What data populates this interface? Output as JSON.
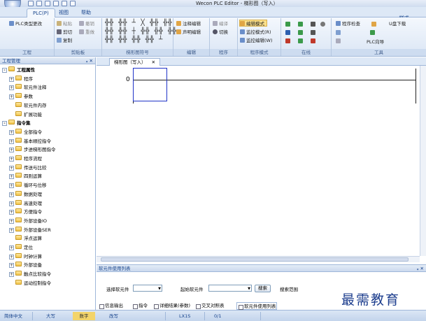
{
  "window": {
    "title": "Wecon PLC Editor - 梯形图（写入）"
  },
  "menu_tabs": [
    {
      "label": "PLC(P)",
      "active": true
    },
    {
      "label": "视图",
      "active": false
    },
    {
      "label": "帮助",
      "active": false
    }
  ],
  "style_menu": "样式 ·",
  "ribbon": {
    "project": {
      "group_label": "工程",
      "plc_type_change": "PLC类型更改"
    },
    "clipboard": {
      "group_label": "剪贴板",
      "paste": "粘贴",
      "undo": "撤销",
      "cut": "剪切",
      "redo": "重做",
      "copy": "复制"
    },
    "ladder_symbols": {
      "group_label": "梯形图符号",
      "rows": [
        "╬╬ ╬╬ ┴ ╳ ╬╬ ╬╬",
        "╬╬ ╬╬ ┼ ╬╬ ╬╬ ╬╬",
        "╬╬ ╬╬ ╬╬ ╬╬ ┴"
      ]
    },
    "edit": {
      "group_label": "编辑",
      "comment_edit": "注释编辑",
      "statement_edit": "声明编辑"
    },
    "program": {
      "group_label": "程序",
      "compile": "编译",
      "switch": "切换"
    },
    "program_mode": {
      "group_label": "程序模式",
      "edit_mode": "编辑模式",
      "monitor_mode": "监控模式(R)",
      "monitor_edit": "监控编辑(W)"
    },
    "online": {
      "group_label": "在线"
    },
    "tools": {
      "group_label": "工具",
      "program_check": "程序检查",
      "plc_wizard": "PLC向导"
    },
    "u_download": "U盘下载"
  },
  "left_panel": {
    "header": "工程管理",
    "pin": "ᵩ ✕",
    "tree": [
      {
        "label": "工程属性",
        "bold": true,
        "level": 0,
        "toggle": "-"
      },
      {
        "label": "程序",
        "level": 1,
        "toggle": "+"
      },
      {
        "label": "软元件注释",
        "level": 1,
        "toggle": "+"
      },
      {
        "label": "参数",
        "level": 1,
        "toggle": "+"
      },
      {
        "label": "软元件内存",
        "level": 1,
        "toggle": ""
      },
      {
        "label": "扩展功能",
        "level": 1,
        "toggle": ""
      },
      {
        "label": "指令集",
        "bold": true,
        "level": 0,
        "toggle": "-"
      },
      {
        "label": "全部指令",
        "level": 1,
        "toggle": "+"
      },
      {
        "label": "基本顺控指令",
        "level": 1,
        "toggle": "+"
      },
      {
        "label": "步进梯形图指令",
        "level": 1,
        "toggle": "+"
      },
      {
        "label": "程序流程",
        "level": 1,
        "toggle": "+"
      },
      {
        "label": "传送与比较",
        "level": 1,
        "toggle": "+"
      },
      {
        "label": "四则运算",
        "level": 1,
        "toggle": "+"
      },
      {
        "label": "循环与位移",
        "level": 1,
        "toggle": "+"
      },
      {
        "label": "数据处理",
        "level": 1,
        "toggle": "+"
      },
      {
        "label": "高速处理",
        "level": 1,
        "toggle": "+"
      },
      {
        "label": "方便指令",
        "level": 1,
        "toggle": "+"
      },
      {
        "label": "外部设备IO",
        "level": 1,
        "toggle": "+"
      },
      {
        "label": "外部设备SER",
        "level": 1,
        "toggle": "+"
      },
      {
        "label": "浮点运算",
        "level": 1,
        "toggle": ""
      },
      {
        "label": "定位",
        "level": 1,
        "toggle": "+"
      },
      {
        "label": "时钟计算",
        "level": 1,
        "toggle": "+"
      },
      {
        "label": "外部设备",
        "level": 1,
        "toggle": "+"
      },
      {
        "label": "触点比较指令",
        "level": 1,
        "toggle": "+"
      },
      {
        "label": "运动控制指令",
        "level": 1,
        "toggle": ""
      }
    ]
  },
  "editor": {
    "tab_label": "梯形图（写入）",
    "tab_close": "✕",
    "step_number": "0"
  },
  "bottom_panel": {
    "header": "软元件使用列表",
    "pin": "ᵩ ✕",
    "select_label": "选择软元件",
    "start_label": "起始软元件",
    "search_button": "搜索",
    "range_label": "搜索范围",
    "tabs": [
      {
        "label": "信息输出",
        "active": false
      },
      {
        "label": "指令",
        "active": false
      },
      {
        "label": "详细结果(参数)",
        "active": false
      },
      {
        "label": "交叉对照表",
        "active": false
      },
      {
        "label": "软元件使用列表",
        "active": true
      }
    ]
  },
  "status_bar": {
    "language": "简体中文",
    "caps": "大写",
    "num": "数字",
    "overwrite": "改写",
    "model": "LX1S",
    "position": "0/1"
  },
  "watermark": "最需教育"
}
